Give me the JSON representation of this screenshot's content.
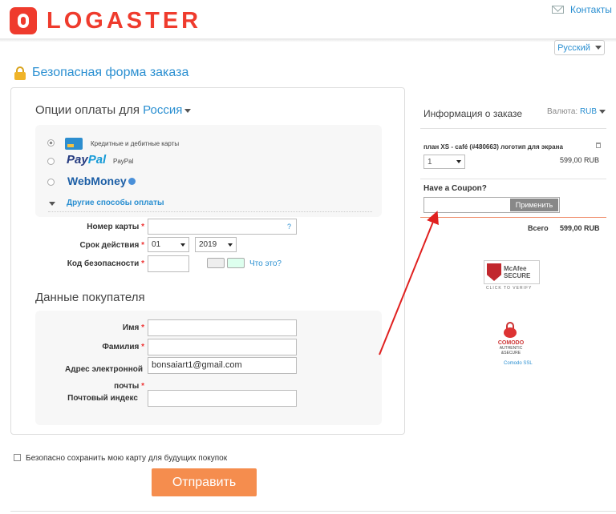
{
  "header": {
    "logo_text": "LOGASTER",
    "contacts_label": "Контакты",
    "language": "Русский"
  },
  "page_title": "Безопасная форма заказа",
  "payment": {
    "heading": "Опции оплаты для",
    "country": "Россия",
    "methods": [
      {
        "label": "Кредитные и дебитные карты",
        "selected": true
      },
      {
        "label": "PayPal",
        "brand": "PayPal",
        "selected": false
      },
      {
        "label": "WebMoney",
        "brand": "WebMoney",
        "selected": false
      }
    ],
    "other_methods": "Другие способы оплаты",
    "card_number_label": "Номер карты",
    "card_number_help": "?",
    "expiry_label": "Срок действия",
    "expiry_month": "01",
    "expiry_year": "2019",
    "cvv_label": "Код безопасности",
    "cvv_help": "Что это?",
    "required_mark": "*"
  },
  "buyer": {
    "heading": "Данные покупателя",
    "first_name_label": "Имя",
    "last_name_label": "Фамилия",
    "email_label_1": "Адрес электронной",
    "email_label_2": "почты",
    "email_value": "bonsaiart1@gmail.com",
    "zip_label": "Почтовый индекс"
  },
  "save_card_label": "Безопасно сохранить мою карту для будущих покупок",
  "submit_label": "Отправить",
  "order": {
    "heading": "Информация о заказе",
    "currency_label": "Валюта:",
    "currency": "RUB",
    "item_name": "план XS - café (#480663) логотип для экрана",
    "quantity": "1",
    "item_price": "599,00 RUB",
    "coupon_label": "Have a Coupon?",
    "apply_label": "Применить",
    "total_label": "Всего",
    "total_value": "599,00 RUB"
  },
  "badges": {
    "mcafee_line1": "McAfee",
    "mcafee_line2": "SECURE",
    "mcafee_sub": "CLICK TO VERIFY",
    "comodo": "COMODO",
    "comodo_sub1": "AUTHENTIC",
    "comodo_sub2": "&SECURE",
    "comodo_ssl": "Comodo SSL"
  },
  "colors": {
    "brand": "#ef3b2d",
    "link": "#2a8fd1",
    "submit": "#f58d4e",
    "annotation_arrow": "#e0201f"
  }
}
